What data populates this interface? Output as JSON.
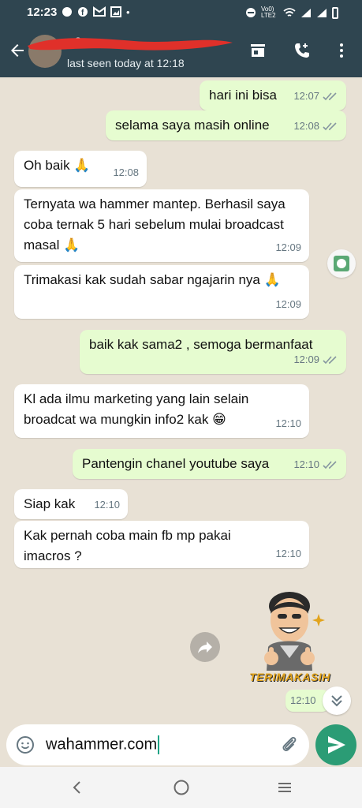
{
  "status_bar": {
    "time": "12:23",
    "notif_icons": [
      "chat-icon",
      "facebook-icon",
      "gmail-icon",
      "gallery-icon"
    ],
    "dot": "•",
    "network": "Vo0) LTE2"
  },
  "header": {
    "contact_name": "+6",
    "last_seen": "last seen today at 12:18"
  },
  "messages": [
    {
      "dir": "out",
      "text": "hari ini bisa",
      "time": "12:07"
    },
    {
      "dir": "out",
      "text": "selama saya masih online",
      "time": "12:08"
    },
    {
      "dir": "in",
      "text": "Oh baik 🙏",
      "time": "12:08"
    },
    {
      "dir": "in",
      "text": "Ternyata wa hammer mantep. Berhasil saya coba ternak 5 hari sebelum mulai broadcast masal 🙏",
      "time": "12:09"
    },
    {
      "dir": "in",
      "text": "Trimakasi kak sudah sabar ngajarin nya 🙏",
      "time": "12:09"
    },
    {
      "dir": "out",
      "text": "baik kak sama2 , semoga bermanfaat",
      "time": "12:09"
    },
    {
      "dir": "in",
      "text": "Kl ada ilmu marketing yang lain selain broadcat wa mungkin info2 kak 😁",
      "time": "12:10"
    },
    {
      "dir": "out",
      "text": "Pantengin chanel youtube saya",
      "time": "12:10"
    },
    {
      "dir": "in",
      "text": "Siap kak",
      "time": "12:10"
    },
    {
      "dir": "in",
      "text": "Kak pernah coba main fb mp pakai imacros ?",
      "time": "12:10"
    }
  ],
  "sticker": {
    "label": "TERIMAKASIH",
    "time": "12:10"
  },
  "composer": {
    "value": "wahammer.com"
  },
  "colors": {
    "header": "#2f4550",
    "outgoing": "#e6fcd0",
    "incoming": "#ffffff",
    "send": "#2b9c75",
    "ticks": "#8696a0"
  }
}
